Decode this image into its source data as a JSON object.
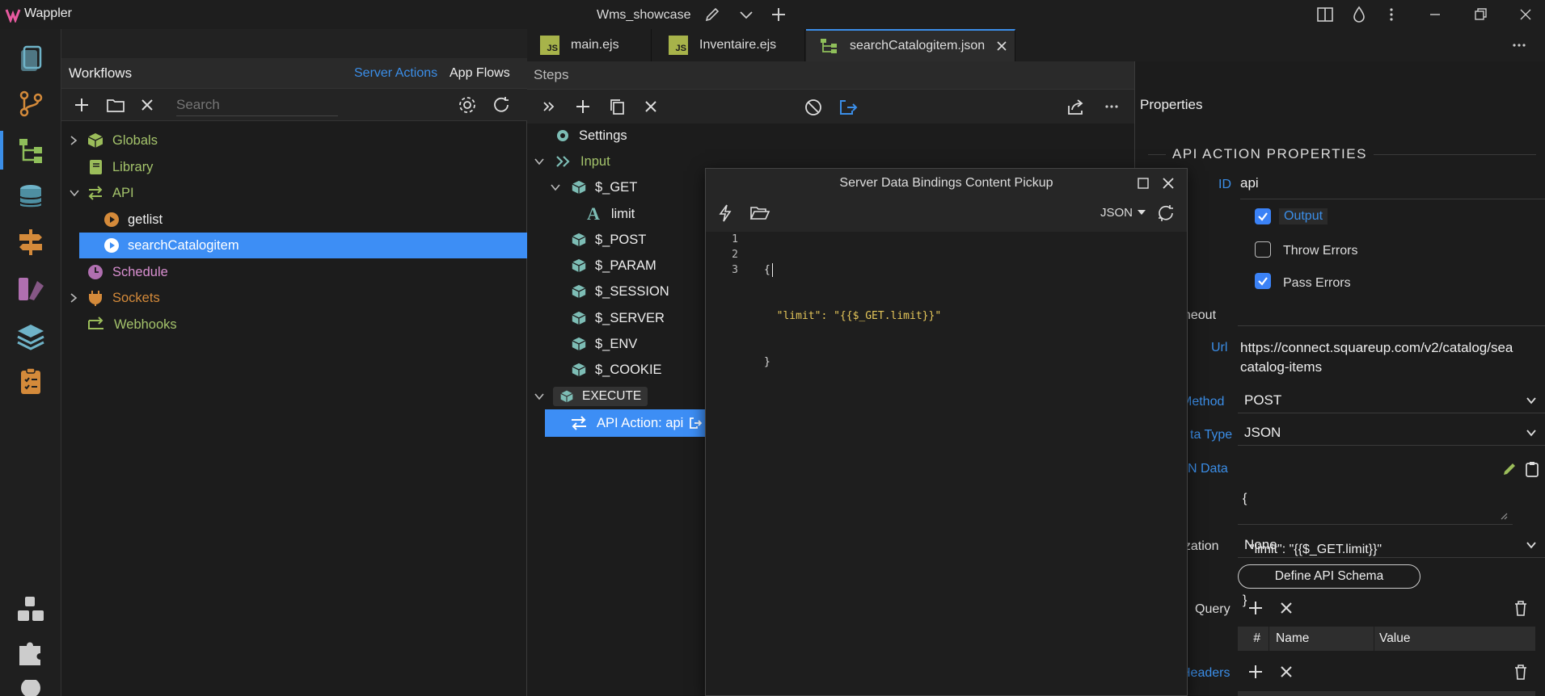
{
  "app": {
    "name": "Wappler",
    "project": "Wms_showcase"
  },
  "tabs": [
    {
      "label": "main.ejs",
      "icon": "js-file-icon"
    },
    {
      "label": "Inventaire.ejs",
      "icon": "js-file-icon"
    },
    {
      "label": "searchCatalogitem.json",
      "icon": "workflow-icon"
    }
  ],
  "workflows": {
    "title": "Workflows",
    "mode_tabs": [
      "Server Actions",
      "App Flows"
    ],
    "search_placeholder": "Search",
    "tree": [
      {
        "label": "Globals",
        "icon": "cube-icon",
        "expander": "collapsed"
      },
      {
        "label": "Library",
        "icon": "book-icon"
      },
      {
        "label": "API",
        "icon": "arrows-icon",
        "expander": "expanded"
      },
      {
        "label": "getlist",
        "icon": "play-circle-icon",
        "child": true
      },
      {
        "label": "searchCatalogitem",
        "icon": "play-circle-icon",
        "child": true,
        "selected": true
      },
      {
        "label": "Schedule",
        "icon": "clock-icon"
      },
      {
        "label": "Sockets",
        "icon": "plug-icon",
        "expander": "collapsed"
      },
      {
        "label": "Webhooks",
        "icon": "hook-icon"
      }
    ]
  },
  "steps": {
    "title": "Steps",
    "tree": [
      {
        "label": "Settings"
      },
      {
        "label": "Input"
      },
      {
        "label": "$_GET"
      },
      {
        "label": "limit"
      },
      {
        "label": "$_POST"
      },
      {
        "label": "$_PARAM"
      },
      {
        "label": "$_SESSION"
      },
      {
        "label": "$_SERVER"
      },
      {
        "label": "$_ENV"
      },
      {
        "label": "$_COOKIE"
      },
      {
        "label": "EXECUTE"
      },
      {
        "label": "API Action: api"
      }
    ]
  },
  "dialog": {
    "title": "Server Data Bindings Content Pickup",
    "format": "JSON",
    "lines": [
      {
        "num": "1",
        "text": "{"
      },
      {
        "num": "2",
        "text": "  \"limit\": \"{{$_GET.limit}}\""
      },
      {
        "num": "3",
        "text": "}"
      }
    ]
  },
  "properties": {
    "title": "Properties",
    "section": "API ACTION PROPERTIES",
    "id_label": "ID",
    "id_value": "api",
    "checks": [
      {
        "label": "Output",
        "checked": true
      },
      {
        "label": "Throw Errors",
        "checked": false
      },
      {
        "label": "Pass Errors",
        "checked": true
      }
    ],
    "timeout_label": "imeout",
    "url_label": "Url",
    "url_line1": "https://connect.squareup.com/v2/catalog/sea",
    "url_line2": "catalog-items",
    "method_label": "Method",
    "method_value": "POST",
    "datatype_label": "ta Type",
    "datatype_value": "JSON",
    "jsondata_label": "N Data",
    "json_line1": "{",
    "json_line2": "  \"limit\": \"{{$_GET.limit}}\"",
    "json_line3": "}",
    "auth_label": "rization",
    "auth_value": "None",
    "schema_button": "Define API Schema",
    "query_label": "Query",
    "table_cols": [
      "#",
      "Name",
      "Value"
    ],
    "headers_label": "Headers"
  },
  "colors": {
    "accent": "#3b8ee8",
    "selected": "#3d8ef5",
    "cube": "#7dbdb5",
    "green": "#a4c36b",
    "orange": "#d48a3a"
  }
}
